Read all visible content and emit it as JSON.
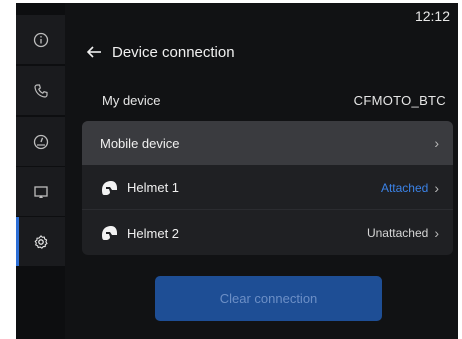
{
  "status": {
    "time": "12:12"
  },
  "header": {
    "title": "Device connection"
  },
  "my_device": {
    "label": "My device",
    "value": "CFMOTO_BTC"
  },
  "list": {
    "mobile": {
      "label": "Mobile device"
    },
    "helmets": [
      {
        "label": "Helmet 1",
        "status": "Attached"
      },
      {
        "label": "Helmet 2",
        "status": "Unattached"
      }
    ]
  },
  "actions": {
    "clear_label": "Clear connection"
  },
  "sidebar": {
    "items": [
      {
        "icon": "info-icon"
      },
      {
        "icon": "phone-icon"
      },
      {
        "icon": "gauge-icon"
      },
      {
        "icon": "cast-icon"
      },
      {
        "icon": "settings-icon",
        "active": true
      }
    ]
  },
  "colors": {
    "accent": "#3b82e6",
    "button_bg": "#1e4e95",
    "background": "#111214",
    "card": "#1f2023",
    "selected_row": "#3a3b3f"
  }
}
